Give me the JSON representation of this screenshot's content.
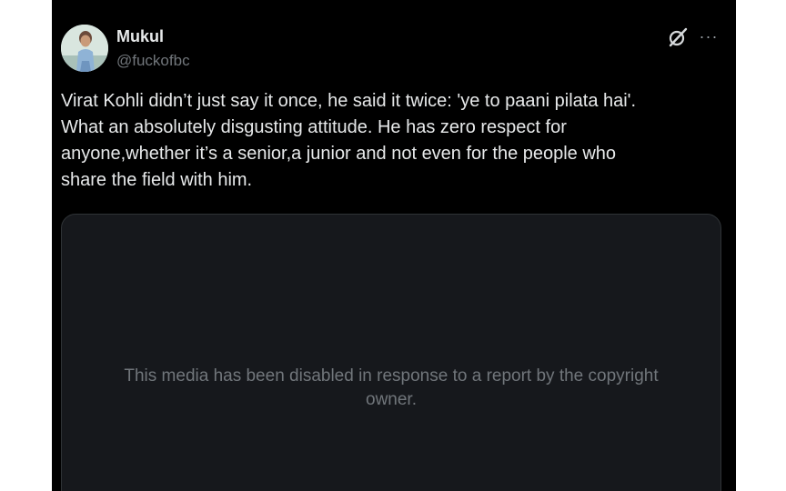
{
  "tweet": {
    "author": {
      "display_name": "Mukul",
      "handle": "@fuckofbc",
      "avatar_icon": "avatar-photo"
    },
    "text": "Virat Kohli didn’t just say it once, he said it twice: 'ye to paani pilata hai'.\nWhat an absolutely disgusting attitude. He has zero respect for\nanyone,whether it’s a senior,a junior and not even for the people who\nshare the field with him.",
    "media": {
      "notice": "This media has been disabled in response to a report by the copyright\nowner."
    },
    "actions": {
      "grok_icon": "grok-icon",
      "more_icon": "more-options-icon",
      "more_label": "···"
    }
  },
  "colors": {
    "background": "#000000",
    "page_background": "#ffffff",
    "primary_text": "#e7e9ea",
    "secondary_text": "#71767b",
    "media_background": "#16181c",
    "media_border": "#2f3336"
  }
}
